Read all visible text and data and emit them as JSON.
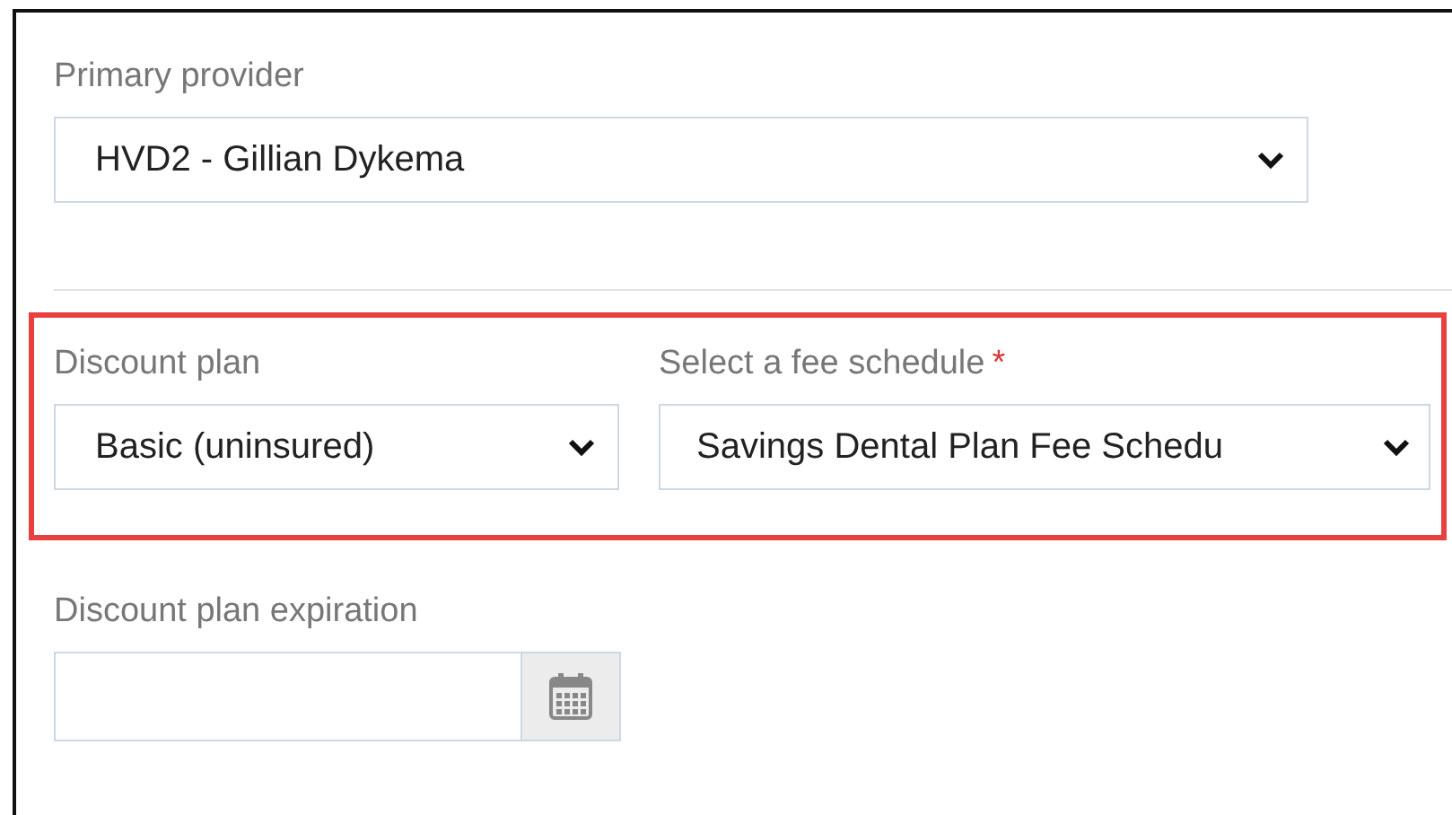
{
  "primary_provider": {
    "label": "Primary provider",
    "value": "HVD2 - Gillian Dykema"
  },
  "highlighted_group": {
    "discount_plan": {
      "label": "Discount plan",
      "value": "Basic (uninsured)"
    },
    "fee_schedule": {
      "label": "Select a fee schedule",
      "required_mark": "*",
      "value": "Savings Dental Plan Fee Schedu"
    }
  },
  "expiration": {
    "label": "Discount plan expiration"
  }
}
